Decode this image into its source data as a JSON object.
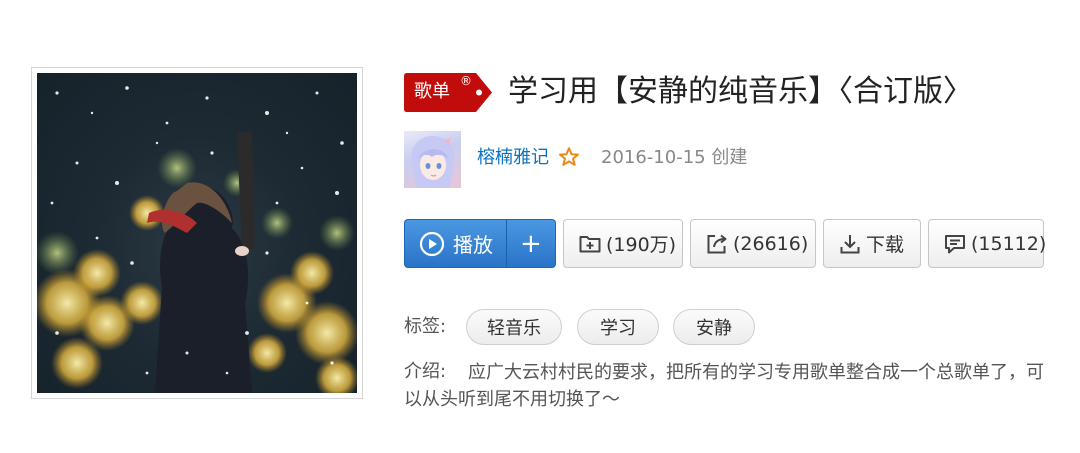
{
  "playlist": {
    "badge": "歌单",
    "badge_reg": "®",
    "title": "学习用【安静的纯音乐】〈合订版〉"
  },
  "creator": {
    "name": "榕楠雅记",
    "created": "2016-10-15 创建"
  },
  "actions": {
    "play_label": "播放",
    "add_label": "+",
    "favorite_label": "(190万)",
    "share_label": "(26616)",
    "download_label": "下载",
    "comment_label": "(15112)"
  },
  "tags": {
    "label": "标签:",
    "items": [
      "轻音乐",
      "学习",
      "安静"
    ]
  },
  "intro": {
    "label": "介绍:",
    "text": "应广大云村村民的要求，把所有的学习专用歌单整合成一个总歌单了，可以从头听到尾不用切换了～"
  },
  "colors": {
    "accent_blue": "#2a74c8",
    "badge_red": "#c20c0c",
    "link_blue": "#0c73c2"
  },
  "icons": [
    "play-icon",
    "add-icon",
    "favorite-folder-icon",
    "share-icon",
    "download-icon",
    "comment-icon",
    "star-icon"
  ]
}
